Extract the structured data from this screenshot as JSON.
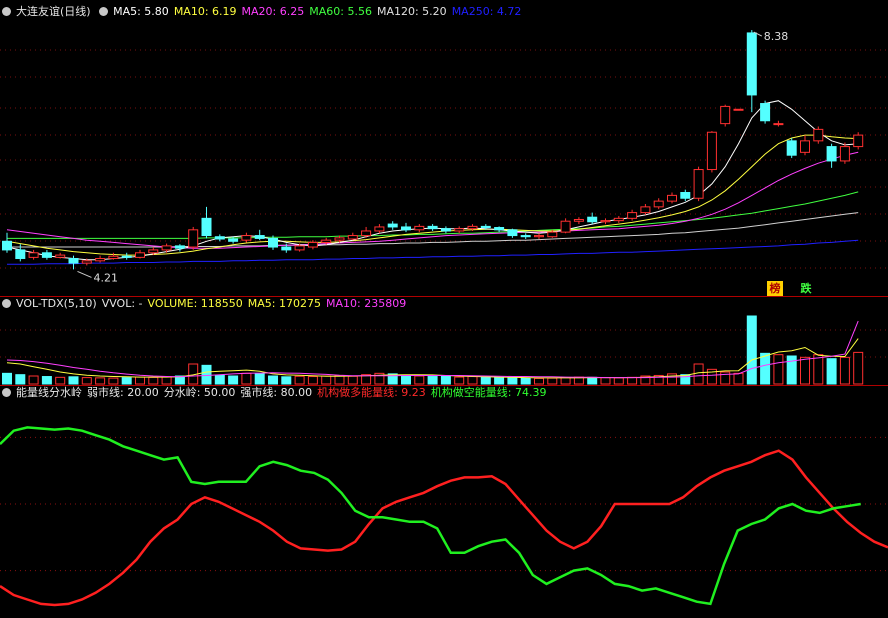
{
  "main_legend": {
    "name": "大连友谊(日线)",
    "ma": [
      {
        "label": "MA5: 5.80",
        "color": "#ffffff"
      },
      {
        "label": "MA10: 6.19",
        "color": "#ffff40"
      },
      {
        "label": "MA20: 6.25",
        "color": "#ff40ff"
      },
      {
        "label": "MA60: 5.56",
        "color": "#40ff40"
      },
      {
        "label": "MA120: 5.20",
        "color": "#e0e0e0"
      },
      {
        "label": "MA250: 4.72",
        "color": "#2020ff"
      }
    ]
  },
  "vol_legend": {
    "name": "VOL-TDX(5,10)",
    "vvol": "VVOL: -",
    "volume": "VOLUME: 118550",
    "ma5": "MA5: 170275",
    "ma10": "MA10: 235809"
  },
  "ind_legend": {
    "name": "能量线分水岭",
    "weak": "弱市线: 20.00",
    "divide": "分水岭: 50.00",
    "strong": "强市线: 80.00",
    "long_line": "机构做多能量线: 9.23",
    "short_line": "机构做空能量线: 74.39"
  },
  "tags": {
    "bang": "榜",
    "die": "跌"
  },
  "colors": {
    "up": "#ff3030",
    "down": "#54ffff",
    "bull_line": "#ff2020",
    "bear_line": "#20f020"
  },
  "chart_data": {
    "type": "candlestick",
    "price_high_label": "8.38",
    "price_low_label": "4.21",
    "candles": [
      [
        4.7,
        4.55,
        4.85,
        4.5
      ],
      [
        4.55,
        4.4,
        4.65,
        4.35
      ],
      [
        4.42,
        4.5,
        4.55,
        4.38
      ],
      [
        4.5,
        4.42,
        4.55,
        4.38
      ],
      [
        4.42,
        4.46,
        4.5,
        4.4
      ],
      [
        4.4,
        4.32,
        4.45,
        4.21
      ],
      [
        4.32,
        4.36,
        4.4,
        4.28
      ],
      [
        4.36,
        4.4,
        4.45,
        4.33
      ],
      [
        4.4,
        4.44,
        4.5,
        4.38
      ],
      [
        4.44,
        4.42,
        4.5,
        4.38
      ],
      [
        4.42,
        4.5,
        4.55,
        4.4
      ],
      [
        4.5,
        4.55,
        4.6,
        4.46
      ],
      [
        4.55,
        4.62,
        4.66,
        4.5
      ],
      [
        4.62,
        4.58,
        4.65,
        4.52
      ],
      [
        4.6,
        4.9,
        4.95,
        4.55
      ],
      [
        5.1,
        4.8,
        5.3,
        4.75
      ],
      [
        4.78,
        4.74,
        4.82,
        4.7
      ],
      [
        4.74,
        4.7,
        4.78,
        4.66
      ],
      [
        4.72,
        4.8,
        4.85,
        4.68
      ],
      [
        4.8,
        4.75,
        4.9,
        4.72
      ],
      [
        4.75,
        4.6,
        4.8,
        4.55
      ],
      [
        4.6,
        4.55,
        4.66,
        4.5
      ],
      [
        4.55,
        4.62,
        4.66,
        4.52
      ],
      [
        4.6,
        4.68,
        4.72,
        4.56
      ],
      [
        4.68,
        4.72,
        4.76,
        4.64
      ],
      [
        4.72,
        4.76,
        4.8,
        4.68
      ],
      [
        4.74,
        4.8,
        4.85,
        4.72
      ],
      [
        4.8,
        4.88,
        4.95,
        4.76
      ],
      [
        4.88,
        4.95,
        5.0,
        4.84
      ],
      [
        5.0,
        4.95,
        5.05,
        4.9
      ],
      [
        4.95,
        4.9,
        5.02,
        4.86
      ],
      [
        4.9,
        4.96,
        5.0,
        4.86
      ],
      [
        4.96,
        4.92,
        5.0,
        4.88
      ],
      [
        4.92,
        4.88,
        4.96,
        4.84
      ],
      [
        4.88,
        4.92,
        4.96,
        4.84
      ],
      [
        4.92,
        4.96,
        5.0,
        4.88
      ],
      [
        4.96,
        4.94,
        5.0,
        4.9
      ],
      [
        4.94,
        4.9,
        4.96,
        4.86
      ],
      [
        4.9,
        4.8,
        4.92,
        4.76
      ],
      [
        4.8,
        4.78,
        4.84,
        4.74
      ],
      [
        4.78,
        4.8,
        4.84,
        4.74
      ],
      [
        4.78,
        4.86,
        4.9,
        4.76
      ],
      [
        4.86,
        5.05,
        5.1,
        4.84
      ],
      [
        5.05,
        5.08,
        5.12,
        5.0
      ],
      [
        5.12,
        5.04,
        5.2,
        5.0
      ],
      [
        5.04,
        5.06,
        5.1,
        5.0
      ],
      [
        5.06,
        5.1,
        5.14,
        5.02
      ],
      [
        5.1,
        5.2,
        5.25,
        5.06
      ],
      [
        5.2,
        5.3,
        5.35,
        5.16
      ],
      [
        5.3,
        5.4,
        5.45,
        5.26
      ],
      [
        5.4,
        5.5,
        5.55,
        5.36
      ],
      [
        5.55,
        5.45,
        5.6,
        5.4
      ],
      [
        5.45,
        5.95,
        6.0,
        5.4
      ],
      [
        5.95,
        6.6,
        6.62,
        5.9
      ],
      [
        6.75,
        7.05,
        7.08,
        6.7
      ],
      [
        7.0,
        7.0,
        7.0,
        7.0
      ],
      [
        8.33,
        7.25,
        8.38,
        6.95
      ],
      [
        7.1,
        6.8,
        7.15,
        6.75
      ],
      [
        6.75,
        6.75,
        6.8,
        6.7
      ],
      [
        6.45,
        6.2,
        6.5,
        6.15
      ],
      [
        6.25,
        6.45,
        6.55,
        6.2
      ],
      [
        6.45,
        6.65,
        6.7,
        6.4
      ],
      [
        6.35,
        6.1,
        6.4,
        5.98
      ],
      [
        6.1,
        6.35,
        6.42,
        6.05
      ],
      [
        6.35,
        6.55,
        6.6,
        6.3
      ]
    ],
    "ma5": [
      4.6,
      4.55,
      4.5,
      4.45,
      4.42,
      4.4,
      4.38,
      4.38,
      4.4,
      4.42,
      4.44,
      4.48,
      4.52,
      4.56,
      4.62,
      4.7,
      4.76,
      4.78,
      4.8,
      4.78,
      4.74,
      4.68,
      4.64,
      4.62,
      4.64,
      4.68,
      4.72,
      4.78,
      4.84,
      4.88,
      4.9,
      4.92,
      4.93,
      4.92,
      4.92,
      4.93,
      4.92,
      4.9,
      4.88,
      4.86,
      4.84,
      4.86,
      4.9,
      4.95,
      5.0,
      5.05,
      5.08,
      5.12,
      5.16,
      5.22,
      5.3,
      5.38,
      5.5,
      5.7,
      6.0,
      6.4,
      6.85,
      7.1,
      7.15,
      7.0,
      6.8,
      6.6,
      6.45,
      6.38,
      6.4
    ],
    "ma10": [
      4.7,
      4.66,
      4.62,
      4.58,
      4.55,
      4.52,
      4.5,
      4.48,
      4.47,
      4.46,
      4.46,
      4.47,
      4.48,
      4.5,
      4.53,
      4.57,
      4.6,
      4.64,
      4.67,
      4.69,
      4.7,
      4.7,
      4.69,
      4.68,
      4.68,
      4.69,
      4.71,
      4.73,
      4.76,
      4.79,
      4.82,
      4.84,
      4.86,
      4.88,
      4.89,
      4.9,
      4.91,
      4.91,
      4.9,
      4.89,
      4.88,
      4.88,
      4.89,
      4.91,
      4.94,
      4.97,
      5.0,
      5.03,
      5.07,
      5.11,
      5.16,
      5.22,
      5.3,
      5.42,
      5.58,
      5.78,
      6.0,
      6.22,
      6.4,
      6.5,
      6.55,
      6.55,
      6.52,
      6.5,
      6.49
    ],
    "ma20": [
      4.9,
      4.87,
      4.84,
      4.81,
      4.78,
      4.75,
      4.72,
      4.7,
      4.68,
      4.66,
      4.64,
      4.62,
      4.6,
      4.59,
      4.58,
      4.58,
      4.58,
      4.59,
      4.6,
      4.61,
      4.62,
      4.63,
      4.64,
      4.65,
      4.66,
      4.67,
      4.68,
      4.69,
      4.7,
      4.72,
      4.74,
      4.76,
      4.78,
      4.8,
      4.81,
      4.82,
      4.83,
      4.84,
      4.85,
      4.86,
      4.86,
      4.87,
      4.88,
      4.89,
      4.9,
      4.91,
      4.92,
      4.94,
      4.96,
      4.98,
      5.01,
      5.05,
      5.1,
      5.17,
      5.26,
      5.37,
      5.5,
      5.63,
      5.76,
      5.87,
      5.97,
      6.06,
      6.13,
      6.2,
      6.25
    ],
    "ma60": [
      4.75,
      4.75,
      4.75,
      4.75,
      4.75,
      4.75,
      4.75,
      4.75,
      4.75,
      4.75,
      4.75,
      4.75,
      4.75,
      4.75,
      4.75,
      4.76,
      4.76,
      4.76,
      4.76,
      4.77,
      4.77,
      4.77,
      4.78,
      4.78,
      4.78,
      4.79,
      4.79,
      4.8,
      4.8,
      4.81,
      4.81,
      4.82,
      4.82,
      4.83,
      4.84,
      4.84,
      4.85,
      4.86,
      4.87,
      4.88,
      4.89,
      4.9,
      4.91,
      4.92,
      4.93,
      4.95,
      4.96,
      4.98,
      5.0,
      5.02,
      5.04,
      5.06,
      5.08,
      5.1,
      5.13,
      5.16,
      5.19,
      5.23,
      5.27,
      5.31,
      5.35,
      5.4,
      5.45,
      5.5,
      5.56
    ],
    "ma120": [
      4.6,
      4.6,
      4.6,
      4.6,
      4.6,
      4.6,
      4.6,
      4.6,
      4.6,
      4.6,
      4.6,
      4.6,
      4.6,
      4.61,
      4.61,
      4.61,
      4.61,
      4.62,
      4.62,
      4.62,
      4.63,
      4.63,
      4.63,
      4.64,
      4.64,
      4.64,
      4.65,
      4.65,
      4.66,
      4.66,
      4.67,
      4.67,
      4.68,
      4.68,
      4.69,
      4.7,
      4.7,
      4.71,
      4.72,
      4.72,
      4.73,
      4.74,
      4.75,
      4.76,
      4.77,
      4.78,
      4.79,
      4.8,
      4.81,
      4.82,
      4.84,
      4.85,
      4.87,
      4.89,
      4.91,
      4.93,
      4.96,
      4.99,
      5.02,
      5.05,
      5.08,
      5.11,
      5.14,
      5.17,
      5.2
    ],
    "ma250": [
      4.3,
      4.3,
      4.3,
      4.31,
      4.31,
      4.31,
      4.32,
      4.32,
      4.32,
      4.33,
      4.33,
      4.33,
      4.34,
      4.34,
      4.35,
      4.35,
      4.35,
      4.36,
      4.36,
      4.37,
      4.37,
      4.38,
      4.38,
      4.38,
      4.39,
      4.39,
      4.4,
      4.4,
      4.41,
      4.41,
      4.42,
      4.42,
      4.43,
      4.43,
      4.44,
      4.44,
      4.45,
      4.45,
      4.46,
      4.46,
      4.47,
      4.47,
      4.48,
      4.49,
      4.49,
      4.5,
      4.51,
      4.51,
      4.52,
      4.53,
      4.54,
      4.55,
      4.56,
      4.57,
      4.58,
      4.59,
      4.6,
      4.61,
      4.62,
      4.64,
      4.65,
      4.67,
      4.68,
      4.7,
      4.72
    ],
    "volume": [
      40000,
      35000,
      30000,
      28000,
      25000,
      27000,
      24000,
      23000,
      22000,
      24000,
      26000,
      25000,
      27000,
      30000,
      75000,
      70000,
      32000,
      30000,
      40000,
      38000,
      30000,
      27000,
      29000,
      28000,
      30000,
      32000,
      29000,
      35000,
      40000,
      38000,
      33000,
      30000,
      28000,
      29000,
      26000,
      28000,
      25000,
      24000,
      23000,
      22000,
      21000,
      22000,
      24000,
      26000,
      25000,
      24000,
      23000,
      25000,
      30000,
      32000,
      38000,
      35000,
      75000,
      55000,
      45000,
      40000,
      255000,
      115000,
      110000,
      105000,
      100000,
      110000,
      95000,
      100000,
      118550
    ],
    "vol_ma5": [
      80000,
      75000,
      65000,
      55000,
      45000,
      38000,
      33000,
      30000,
      28000,
      27000,
      26000,
      26000,
      26000,
      27000,
      34000,
      45000,
      48000,
      50000,
      52000,
      48000,
      38000,
      34000,
      33000,
      31000,
      29000,
      29000,
      30000,
      31000,
      33000,
      34000,
      35000,
      35000,
      34000,
      32000,
      30000,
      28000,
      27000,
      26000,
      25000,
      24000,
      23000,
      23000,
      23000,
      23000,
      24000,
      24000,
      24000,
      24000,
      25000,
      27000,
      30000,
      32000,
      42000,
      45000,
      49000,
      50000,
      90000,
      105000,
      120000,
      125000,
      137000,
      108000,
      104000,
      103000,
      170275
    ],
    "vol_ma10": [
      90000,
      88000,
      84000,
      78000,
      70000,
      62000,
      55000,
      48000,
      42000,
      37000,
      33000,
      30000,
      28000,
      27000,
      30000,
      32000,
      35000,
      38000,
      40000,
      41000,
      42000,
      41000,
      40000,
      38000,
      36000,
      33000,
      31000,
      31000,
      31000,
      31000,
      32000,
      32000,
      32000,
      32000,
      32000,
      31000,
      30000,
      29000,
      28000,
      28000,
      27000,
      27000,
      26000,
      25000,
      25000,
      24000,
      24000,
      24000,
      24000,
      25000,
      26000,
      27000,
      31000,
      33000,
      36000,
      38000,
      58000,
      70000,
      80000,
      86000,
      93000,
      98000,
      104000,
      112000,
      235809
    ],
    "energy_long": [
      13,
      9,
      7,
      5,
      4.5,
      5,
      7,
      10,
      14,
      19,
      25,
      33,
      39,
      43,
      50,
      53,
      51,
      48,
      45,
      42,
      38,
      33,
      30,
      29.5,
      29,
      29.5,
      33,
      41,
      48,
      51,
      53,
      55,
      58,
      60.5,
      62,
      62,
      62.5,
      59,
      52,
      45,
      38,
      33,
      30,
      33,
      40,
      50,
      50,
      50,
      50,
      50,
      53,
      58,
      62,
      65,
      67,
      69,
      72,
      74,
      70,
      62,
      55,
      48,
      42,
      37,
      33,
      30.5
    ],
    "energy_short": [
      77,
      83,
      84.5,
      84,
      83.5,
      84,
      83,
      81,
      79,
      76,
      74,
      72,
      70,
      71,
      60,
      59,
      60,
      60,
      60,
      67,
      69,
      67.5,
      65,
      64,
      61,
      55,
      47,
      44,
      44,
      43,
      42,
      42,
      39,
      28,
      28,
      31,
      33,
      34,
      28,
      18,
      14,
      17,
      20,
      21,
      18,
      14,
      13,
      11,
      12,
      10,
      8,
      6,
      5,
      23,
      38,
      41,
      43,
      48,
      50,
      47,
      46,
      48,
      49,
      50
    ]
  }
}
